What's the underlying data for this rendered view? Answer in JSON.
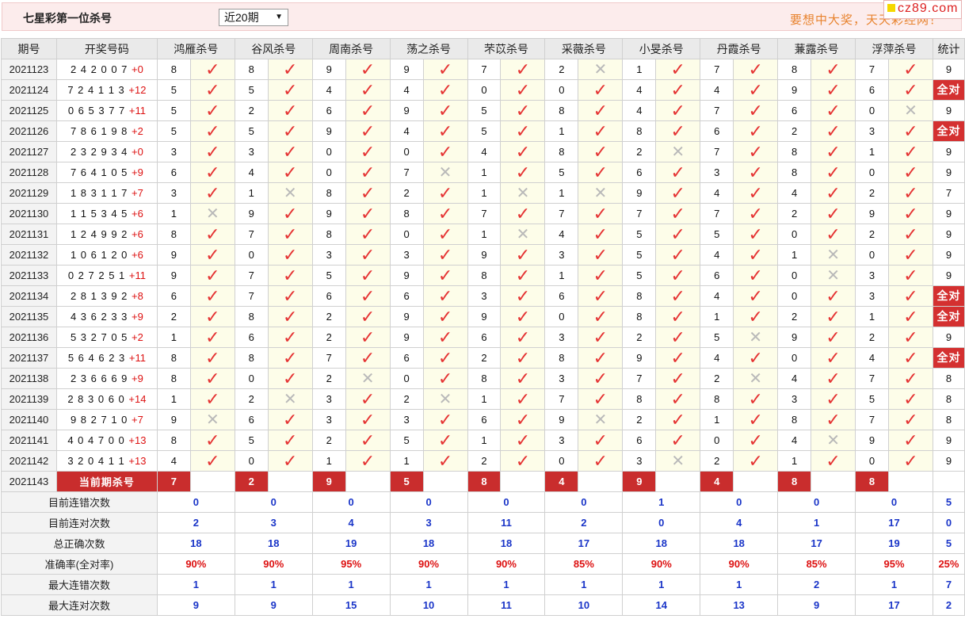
{
  "header": {
    "title": "七星彩第一位杀号",
    "period_select": "近20期",
    "slogan": "要想中大奖，天天彩经网！",
    "brand": "cz89.com"
  },
  "columns": {
    "issue": "期号",
    "draw": "开奖号码",
    "experts": [
      "鸿雁杀号",
      "谷风杀号",
      "周南杀号",
      "荡之杀号",
      "芣苡杀号",
      "采薇杀号",
      "小旻杀号",
      "丹霞杀号",
      "蒹露杀号",
      "浮萍杀号"
    ],
    "stat": "统计"
  },
  "rows": [
    {
      "issue": "2021123",
      "draw": "2 4 2 0 0 7",
      "plus": "+0",
      "kills": [
        [
          "8",
          "y"
        ],
        [
          "8",
          "y"
        ],
        [
          "9",
          "y"
        ],
        [
          "9",
          "y"
        ],
        [
          "7",
          "y"
        ],
        [
          "2",
          "n"
        ],
        [
          "1",
          "y"
        ],
        [
          "7",
          "y"
        ],
        [
          "8",
          "y"
        ],
        [
          "7",
          "y"
        ]
      ],
      "stat": "9"
    },
    {
      "issue": "2021124",
      "draw": "7 2 4 1 1 3",
      "plus": "+12",
      "kills": [
        [
          "5",
          "y"
        ],
        [
          "5",
          "y"
        ],
        [
          "4",
          "y"
        ],
        [
          "4",
          "y"
        ],
        [
          "0",
          "y"
        ],
        [
          "0",
          "y"
        ],
        [
          "4",
          "y"
        ],
        [
          "4",
          "y"
        ],
        [
          "9",
          "y"
        ],
        [
          "6",
          "y"
        ]
      ],
      "stat": "全对"
    },
    {
      "issue": "2021125",
      "draw": "0 6 5 3 7 7",
      "plus": "+11",
      "kills": [
        [
          "5",
          "y"
        ],
        [
          "2",
          "y"
        ],
        [
          "6",
          "y"
        ],
        [
          "9",
          "y"
        ],
        [
          "5",
          "y"
        ],
        [
          "8",
          "y"
        ],
        [
          "4",
          "y"
        ],
        [
          "7",
          "y"
        ],
        [
          "6",
          "y"
        ],
        [
          "0",
          "n"
        ]
      ],
      "stat": "9"
    },
    {
      "issue": "2021126",
      "draw": "7 8 6 1 9 8",
      "plus": "+2",
      "kills": [
        [
          "5",
          "y"
        ],
        [
          "5",
          "y"
        ],
        [
          "9",
          "y"
        ],
        [
          "4",
          "y"
        ],
        [
          "5",
          "y"
        ],
        [
          "1",
          "y"
        ],
        [
          "8",
          "y"
        ],
        [
          "6",
          "y"
        ],
        [
          "2",
          "y"
        ],
        [
          "3",
          "y"
        ]
      ],
      "stat": "全对"
    },
    {
      "issue": "2021127",
      "draw": "2 3 2 9 3 4",
      "plus": "+0",
      "kills": [
        [
          "3",
          "y"
        ],
        [
          "3",
          "y"
        ],
        [
          "0",
          "y"
        ],
        [
          "0",
          "y"
        ],
        [
          "4",
          "y"
        ],
        [
          "8",
          "y"
        ],
        [
          "2",
          "n"
        ],
        [
          "7",
          "y"
        ],
        [
          "8",
          "y"
        ],
        [
          "1",
          "y"
        ]
      ],
      "stat": "9"
    },
    {
      "issue": "2021128",
      "draw": "7 6 4 1 0 5",
      "plus": "+9",
      "kills": [
        [
          "6",
          "y"
        ],
        [
          "4",
          "y"
        ],
        [
          "0",
          "y"
        ],
        [
          "7",
          "n"
        ],
        [
          "1",
          "y"
        ],
        [
          "5",
          "y"
        ],
        [
          "6",
          "y"
        ],
        [
          "3",
          "y"
        ],
        [
          "8",
          "y"
        ],
        [
          "0",
          "y"
        ]
      ],
      "stat": "9"
    },
    {
      "issue": "2021129",
      "draw": "1 8 3 1 1 7",
      "plus": "+7",
      "kills": [
        [
          "3",
          "y"
        ],
        [
          "1",
          "n"
        ],
        [
          "8",
          "y"
        ],
        [
          "2",
          "y"
        ],
        [
          "1",
          "n"
        ],
        [
          "1",
          "n"
        ],
        [
          "9",
          "y"
        ],
        [
          "4",
          "y"
        ],
        [
          "4",
          "y"
        ],
        [
          "2",
          "y"
        ]
      ],
      "stat": "7"
    },
    {
      "issue": "2021130",
      "draw": "1 1 5 3 4 5",
      "plus": "+6",
      "kills": [
        [
          "1",
          "n"
        ],
        [
          "9",
          "y"
        ],
        [
          "9",
          "y"
        ],
        [
          "8",
          "y"
        ],
        [
          "7",
          "y"
        ],
        [
          "7",
          "y"
        ],
        [
          "7",
          "y"
        ],
        [
          "7",
          "y"
        ],
        [
          "2",
          "y"
        ],
        [
          "9",
          "y"
        ]
      ],
      "stat": "9"
    },
    {
      "issue": "2021131",
      "draw": "1 2 4 9 9 2",
      "plus": "+6",
      "kills": [
        [
          "8",
          "y"
        ],
        [
          "7",
          "y"
        ],
        [
          "8",
          "y"
        ],
        [
          "0",
          "y"
        ],
        [
          "1",
          "n"
        ],
        [
          "4",
          "y"
        ],
        [
          "5",
          "y"
        ],
        [
          "5",
          "y"
        ],
        [
          "0",
          "y"
        ],
        [
          "2",
          "y"
        ]
      ],
      "stat": "9"
    },
    {
      "issue": "2021132",
      "draw": "1 0 6 1 2 0",
      "plus": "+6",
      "kills": [
        [
          "9",
          "y"
        ],
        [
          "0",
          "y"
        ],
        [
          "3",
          "y"
        ],
        [
          "3",
          "y"
        ],
        [
          "9",
          "y"
        ],
        [
          "3",
          "y"
        ],
        [
          "5",
          "y"
        ],
        [
          "4",
          "y"
        ],
        [
          "1",
          "n"
        ],
        [
          "0",
          "y"
        ]
      ],
      "stat": "9"
    },
    {
      "issue": "2021133",
      "draw": "0 2 7 2 5 1",
      "plus": "+11",
      "kills": [
        [
          "9",
          "y"
        ],
        [
          "7",
          "y"
        ],
        [
          "5",
          "y"
        ],
        [
          "9",
          "y"
        ],
        [
          "8",
          "y"
        ],
        [
          "1",
          "y"
        ],
        [
          "5",
          "y"
        ],
        [
          "6",
          "y"
        ],
        [
          "0",
          "n"
        ],
        [
          "3",
          "y"
        ]
      ],
      "stat": "9"
    },
    {
      "issue": "2021134",
      "draw": "2 8 1 3 9 2",
      "plus": "+8",
      "kills": [
        [
          "6",
          "y"
        ],
        [
          "7",
          "y"
        ],
        [
          "6",
          "y"
        ],
        [
          "6",
          "y"
        ],
        [
          "3",
          "y"
        ],
        [
          "6",
          "y"
        ],
        [
          "8",
          "y"
        ],
        [
          "4",
          "y"
        ],
        [
          "0",
          "y"
        ],
        [
          "3",
          "y"
        ]
      ],
      "stat": "全对"
    },
    {
      "issue": "2021135",
      "draw": "4 3 6 2 3 3",
      "plus": "+9",
      "kills": [
        [
          "2",
          "y"
        ],
        [
          "8",
          "y"
        ],
        [
          "2",
          "y"
        ],
        [
          "9",
          "y"
        ],
        [
          "9",
          "y"
        ],
        [
          "0",
          "y"
        ],
        [
          "8",
          "y"
        ],
        [
          "1",
          "y"
        ],
        [
          "2",
          "y"
        ],
        [
          "1",
          "y"
        ]
      ],
      "stat": "全对"
    },
    {
      "issue": "2021136",
      "draw": "5 3 2 7 0 5",
      "plus": "+2",
      "kills": [
        [
          "1",
          "y"
        ],
        [
          "6",
          "y"
        ],
        [
          "2",
          "y"
        ],
        [
          "9",
          "y"
        ],
        [
          "6",
          "y"
        ],
        [
          "3",
          "y"
        ],
        [
          "2",
          "y"
        ],
        [
          "5",
          "n"
        ],
        [
          "9",
          "y"
        ],
        [
          "2",
          "y"
        ]
      ],
      "stat": "9"
    },
    {
      "issue": "2021137",
      "draw": "5 6 4 6 2 3",
      "plus": "+11",
      "kills": [
        [
          "8",
          "y"
        ],
        [
          "8",
          "y"
        ],
        [
          "7",
          "y"
        ],
        [
          "6",
          "y"
        ],
        [
          "2",
          "y"
        ],
        [
          "8",
          "y"
        ],
        [
          "9",
          "y"
        ],
        [
          "4",
          "y"
        ],
        [
          "0",
          "y"
        ],
        [
          "4",
          "y"
        ]
      ],
      "stat": "全对"
    },
    {
      "issue": "2021138",
      "draw": "2 3 6 6 6 9",
      "plus": "+9",
      "kills": [
        [
          "8",
          "y"
        ],
        [
          "0",
          "y"
        ],
        [
          "2",
          "n"
        ],
        [
          "0",
          "y"
        ],
        [
          "8",
          "y"
        ],
        [
          "3",
          "y"
        ],
        [
          "7",
          "y"
        ],
        [
          "2",
          "n"
        ],
        [
          "4",
          "y"
        ],
        [
          "7",
          "y"
        ]
      ],
      "stat": "8"
    },
    {
      "issue": "2021139",
      "draw": "2 8 3 0 6 0",
      "plus": "+14",
      "kills": [
        [
          "1",
          "y"
        ],
        [
          "2",
          "n"
        ],
        [
          "3",
          "y"
        ],
        [
          "2",
          "n"
        ],
        [
          "1",
          "y"
        ],
        [
          "7",
          "y"
        ],
        [
          "8",
          "y"
        ],
        [
          "8",
          "y"
        ],
        [
          "3",
          "y"
        ],
        [
          "5",
          "y"
        ]
      ],
      "stat": "8"
    },
    {
      "issue": "2021140",
      "draw": "9 8 2 7 1 0",
      "plus": "+7",
      "kills": [
        [
          "9",
          "n"
        ],
        [
          "6",
          "y"
        ],
        [
          "3",
          "y"
        ],
        [
          "3",
          "y"
        ],
        [
          "6",
          "y"
        ],
        [
          "9",
          "n"
        ],
        [
          "2",
          "y"
        ],
        [
          "1",
          "y"
        ],
        [
          "8",
          "y"
        ],
        [
          "7",
          "y"
        ]
      ],
      "stat": "8"
    },
    {
      "issue": "2021141",
      "draw": "4 0 4 7 0 0",
      "plus": "+13",
      "kills": [
        [
          "8",
          "y"
        ],
        [
          "5",
          "y"
        ],
        [
          "2",
          "y"
        ],
        [
          "5",
          "y"
        ],
        [
          "1",
          "y"
        ],
        [
          "3",
          "y"
        ],
        [
          "6",
          "y"
        ],
        [
          "0",
          "y"
        ],
        [
          "4",
          "n"
        ],
        [
          "9",
          "y"
        ]
      ],
      "stat": "9"
    },
    {
      "issue": "2021142",
      "draw": "3 2 0 4 1 1",
      "plus": "+13",
      "kills": [
        [
          "4",
          "y"
        ],
        [
          "0",
          "y"
        ],
        [
          "1",
          "y"
        ],
        [
          "1",
          "y"
        ],
        [
          "2",
          "y"
        ],
        [
          "0",
          "y"
        ],
        [
          "3",
          "n"
        ],
        [
          "2",
          "y"
        ],
        [
          "1",
          "y"
        ],
        [
          "0",
          "y"
        ]
      ],
      "stat": "9"
    }
  ],
  "current": {
    "issue": "2021143",
    "label": "当前期杀号",
    "kills": [
      "7",
      "2",
      "9",
      "5",
      "8",
      "4",
      "9",
      "4",
      "8",
      "8"
    ]
  },
  "summary": [
    {
      "label": "目前连错次数",
      "values": [
        "0",
        "0",
        "0",
        "0",
        "0",
        "0",
        "1",
        "0",
        "0",
        "0"
      ],
      "stat": "5",
      "kind": "blue"
    },
    {
      "label": "目前连对次数",
      "values": [
        "2",
        "3",
        "4",
        "3",
        "11",
        "2",
        "0",
        "4",
        "1",
        "17"
      ],
      "stat": "0",
      "kind": "blue"
    },
    {
      "label": "总正确次数",
      "values": [
        "18",
        "18",
        "19",
        "18",
        "18",
        "17",
        "18",
        "18",
        "17",
        "19"
      ],
      "stat": "5",
      "kind": "blue"
    },
    {
      "label": "准确率(全对率)",
      "values": [
        "90%",
        "90%",
        "95%",
        "90%",
        "90%",
        "85%",
        "90%",
        "90%",
        "85%",
        "95%"
      ],
      "stat": "25%",
      "kind": "red"
    },
    {
      "label": "最大连错次数",
      "values": [
        "1",
        "1",
        "1",
        "1",
        "1",
        "1",
        "1",
        "1",
        "2",
        "1"
      ],
      "stat": "7",
      "kind": "blue"
    },
    {
      "label": "最大连对次数",
      "values": [
        "9",
        "9",
        "15",
        "10",
        "11",
        "10",
        "14",
        "13",
        "9",
        "17"
      ],
      "stat": "2",
      "kind": "blue"
    }
  ],
  "icons": {
    "correct": "check-icon",
    "wrong": "cross-icon"
  },
  "colors": {
    "accent_red": "#d43030",
    "summary_blue": "#1a35c8",
    "check_red": "#e53333",
    "cross_gray": "#b9b9b9"
  }
}
